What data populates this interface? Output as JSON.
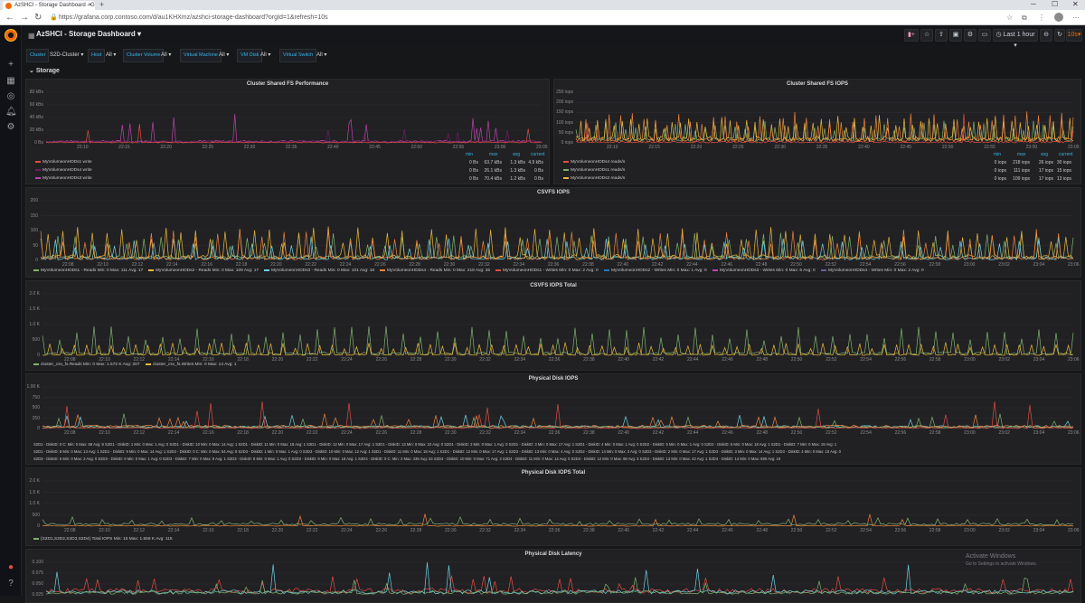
{
  "browser": {
    "tab_title": "AzSHCI - Storage Dashboard - G",
    "url": "https://grafana.corp.contoso.com/d/au1KHXmz/azshci-storage-dashboard?orgId=1&refresh=10s"
  },
  "header": {
    "title": "AzSHCI - Storage Dashboard",
    "time_range": "Last 1 hour",
    "refresh": "10s"
  },
  "variables": [
    {
      "label": "Cluster",
      "value": "S2D-Cluster"
    },
    {
      "label": "Host",
      "value": "All"
    },
    {
      "label": "Cluster Volume",
      "value": "All"
    },
    {
      "label": "Virtual Machine",
      "value": "All"
    },
    {
      "label": "VM Disk",
      "value": "All"
    },
    {
      "label": "Virtual Switch",
      "value": "All"
    }
  ],
  "row_title": "Storage",
  "colors": {
    "green": "#7eb26d",
    "yellow": "#eab839",
    "blue": "#6ed0e0",
    "orange": "#ef843c",
    "red": "#e24d42",
    "purple": "#ba43a9",
    "lightblue": "#1f78c1",
    "pink": "#705da0"
  },
  "panels": {
    "fs_perf": {
      "title": "Cluster Shared FS Performance",
      "yticks": [
        "80 kBs",
        "60 kBs",
        "40 kBs",
        "20 kBs",
        "0 Bs"
      ],
      "xticks": [
        "22:10",
        "22:15",
        "22:20",
        "22:25",
        "22:30",
        "22:35",
        "22:40",
        "22:45",
        "22:50",
        "22:55",
        "23:00",
        "23:05"
      ],
      "headers": [
        "min",
        "max",
        "avg",
        "current"
      ],
      "rows": [
        {
          "name": "MyVolumeonHDDs1 write",
          "color": "#e24d42",
          "min": "0 Bs",
          "max": "63.7 kBs",
          "avg": "1.3 kBs",
          "current": "4.9 kBs"
        },
        {
          "name": "MyVolumeonHDDs4 write",
          "color": "#6d1f62",
          "min": "0 Bs",
          "max": "26.1 kBs",
          "avg": "1.3 kBs",
          "current": "0 Bs"
        },
        {
          "name": "MyVolumeonHDDs3 write",
          "color": "#ba43a9",
          "min": "0 Bs",
          "max": "70.4 kBs",
          "avg": "1.2 kBs",
          "current": "0 Bs"
        }
      ]
    },
    "fs_iops": {
      "title": "Cluster Shared FS IOPS",
      "yticks": [
        "250 iops",
        "200 iops",
        "150 iops",
        "100 iops",
        "50 iops",
        "0 iops"
      ],
      "xticks": [
        "22:10",
        "22:15",
        "22:20",
        "22:25",
        "22:30",
        "22:35",
        "22:40",
        "22:45",
        "22:50",
        "22:55",
        "23:00",
        "23:05"
      ],
      "headers": [
        "min",
        "max",
        "avg",
        "current"
      ],
      "rows": [
        {
          "name": "MyVolumeonHDDs4 reads/s",
          "color": "#e24d42",
          "min": "0 iops",
          "max": "218 iops",
          "avg": "26 iops",
          "current": "30 iops"
        },
        {
          "name": "MyVolumeonHDDs1 reads/s",
          "color": "#7eb26d",
          "min": "0 iops",
          "max": "111 iops",
          "avg": "17 iops",
          "current": "15 iops"
        },
        {
          "name": "MyVolumeonHDDs2 reads/s",
          "color": "#eab839",
          "min": "0 iops",
          "max": "109 iops",
          "avg": "17 iops",
          "current": "13 iops"
        }
      ]
    },
    "csvfs_iops": {
      "title": "CSVFS IOPS",
      "yticks": [
        "200",
        "150",
        "100",
        "50",
        "0"
      ],
      "xticks": [
        "22:08",
        "22:10",
        "22:12",
        "22:14",
        "22:16",
        "22:18",
        "22:20",
        "22:22",
        "22:24",
        "22:26",
        "22:28",
        "22:30",
        "22:32",
        "22:34",
        "22:36",
        "22:38",
        "22:40",
        "22:42",
        "22:44",
        "22:46",
        "22:48",
        "22:50",
        "22:52",
        "22:54",
        "22:56",
        "22:58",
        "23:00",
        "23:02",
        "23:04",
        "23:06"
      ],
      "legend": [
        {
          "text": "MyVolumeonHDDs1 - Reads  Min: 0  Max: 111  Avg: 17",
          "color": "#7eb26d"
        },
        {
          "text": "MyVolumeonHDDs2 - Reads  Min: 0  Max: 109  Avg: 17",
          "color": "#eab839"
        },
        {
          "text": "MyVolumeonHDDs3 - Reads  Min: 0  Max: 101  Avg: 18",
          "color": "#6ed0e0"
        },
        {
          "text": "MyVolumeonHDDs4 - Reads  Min: 0  Max: 218  Avg: 26",
          "color": "#ef843c"
        },
        {
          "text": "MyVolumeonHDDs1 - Writes  Min: 0  Max: 2  Avg: 0",
          "color": "#e24d42"
        },
        {
          "text": "MyVolumeonHDDs2 - Writes  Min: 0  Max: 1  Avg: 0",
          "color": "#1f78c1"
        },
        {
          "text": "MyVolumeonHDDs3 - Writes  Min: 0  Max: 6  Avg: 0",
          "color": "#ba43a9"
        },
        {
          "text": "MyVolumeonHDDs4 - Writes  Min: 0  Max: 2  Avg: 0",
          "color": "#705da0"
        }
      ]
    },
    "csvfs_total": {
      "title": "CSVFS IOPS Total",
      "yticks": [
        "2.0 K",
        "1.5 K",
        "1.0 K",
        "500",
        "0"
      ],
      "xticks": [
        "22:08",
        "22:10",
        "22:12",
        "22:14",
        "22:16",
        "22:18",
        "22:20",
        "22:22",
        "22:24",
        "22:26",
        "22:28",
        "22:30",
        "22:32",
        "22:34",
        "22:36",
        "22:38",
        "22:40",
        "22:42",
        "22:44",
        "22:46",
        "22:48",
        "22:50",
        "22:52",
        "22:54",
        "22:56",
        "22:58",
        "23:00",
        "23:02",
        "23:04",
        "23:06"
      ],
      "legend": [
        {
          "text": "cluster_csv_fs.Reads  Min: 0  Max: 1.572 K  Avg: 207",
          "color": "#7eb26d"
        },
        {
          "text": "cluster_csv_fs.Writes  Min: 0  Max: 14  Avg: 1",
          "color": "#eab839"
        }
      ]
    },
    "disk_iops": {
      "title": "Physical Disk IOPS",
      "yticks": [
        "1.00 K",
        "750",
        "500",
        "250",
        "0"
      ],
      "xticks": [
        "22:08",
        "22:10",
        "22:12",
        "22:14",
        "22:16",
        "22:18",
        "22:20",
        "22:22",
        "22:24",
        "22:26",
        "22:28",
        "22:30",
        "22:32",
        "22:34",
        "22:36",
        "22:38",
        "22:40",
        "22:42",
        "22:44",
        "22:46",
        "22:48",
        "22:50",
        "22:52",
        "22:54",
        "22:56",
        "22:58",
        "23:00",
        "23:02",
        "23:04",
        "23:06"
      ],
      "legend_line1": "S2D1 - DiskID: 0 C: Min: 0  Max: 58  Avg: 8   S2D1 - DiskID: 1  Min: 0  Max: 1  Avg: 0   S2D1 - DiskID: 10  Min: 0  Max: 14  Avg: 1   S2D1 - DiskID: 11  Min: 0  Max: 18  Avg: 1   S2D1 - DiskID: 12  Min: 0  Max: 17  Avg: 1   S2D1 - DiskID: 13  Min: 0  Max: 22  Avg: 0   S2D1 - DiskID: 2  Min: 0  Max: 1  Avg: 0   S2D1 - DiskID: 3  Min: 0  Max: 17  Avg: 1   S2D1 - DiskID: 4  Min: 0  Max: 1  Avg: 0   S2D2 - DiskID: 5  Min: 0  Max: 1  Avg: 0   S2D2 - DiskID: 6  Min: 0  Max: 18  Avg: 1   S2D1 - DiskID: 7  Min: 0  Max: 19  Avg: 1",
      "legend_line2": "S2D1 - DiskID: 8  Min: 0  Max: 13  Avg: 1   S2D1 - DiskID: 9  Min: 0  Max: 14  Avg: 1   S2D3 - DiskID: 0 C: Min: 0  Max: 54  Avg: 8   S2D3 - DiskID: 1  Min: 0  Max: 1  Avg: 0   S2D3 - DiskID: 10  Min: 0  Max: 12  Avg: 1   S2D1 - DiskID: 11  Min: 0  Max: 18  Avg: 1   S2D1 - DiskID: 12  Min: 0  Max: 17  Avg: 1   S2D3 - DiskID: 13  Min: 0  Max: 4  Avg: 0   S2D2 - DiskID: 14  Min: 0  Max: 3  Avg: 0   S2D3 - DiskID: 2  Min: 0  Max: 17  Avg: 1   S2D3 - DiskID: 3  Min: 0  Max: 14  Avg: 1   S2D3 - DiskID: 4  Min: 0  Max: 10  Avg: 0",
      "legend_line3": "S2D3 - DiskID: 5  Min: 0  Max: 2  Avg: 0   S2D3 - DiskID: 6  Min: 0  Max: 1  Avg: 0   S2D3 - DiskID: 7  Min: 0  Max: 9  Avg: 1   S2D3 - DiskID: 8  Min: 0  Max: 1  Avg: 0   S2D3 - DiskID: 9  Min: 0  Max: 18  Avg: 1   S2D4 - DiskID: 0 C: Min: 2  Max: 435  Avg: 34   S2D4 - DiskID: 10  Min: 0  Max: 71  Avg: 3   S2D4 - DiskID: 11  Min: 0  Max: 14  Avg: 0   S2D4 - DiskID: 12  Min: 0  Max: 68  Avg: 3   S2D4 - DiskID: 13  Min: 0  Max: 42  Avg: 1   S2D4 - DiskID: 14  Min: 0  Max: 590  Avg: 19"
    },
    "disk_total": {
      "title": "Physical Disk IOPS Total",
      "yticks": [
        "2.0 K",
        "1.5 K",
        "1.0 K",
        "500",
        "0"
      ],
      "xticks": [
        "22:08",
        "22:10",
        "22:12",
        "22:14",
        "22:16",
        "22:18",
        "22:20",
        "22:22",
        "22:24",
        "22:26",
        "22:28",
        "22:30",
        "22:32",
        "22:34",
        "22:36",
        "22:38",
        "22:40",
        "22:42",
        "22:44",
        "22:46",
        "22:48",
        "22:50",
        "22:52",
        "22:54",
        "22:56",
        "22:58",
        "23:00",
        "23:02",
        "23:04",
        "23:06"
      ],
      "legend": [
        {
          "text": "{S2D1,S2D2,S2D3,S2D4} Total IOPS  Min: 15  Max: 1.558 K  Avg: 115",
          "color": "#7eb26d"
        }
      ]
    },
    "disk_latency": {
      "title": "Physical Disk Latency",
      "yticks": [
        "0.100",
        "0.075",
        "0.050",
        "0.025"
      ]
    }
  },
  "activate": {
    "line1": "Activate Windows",
    "line2": "Go to Settings to activate Windows."
  }
}
